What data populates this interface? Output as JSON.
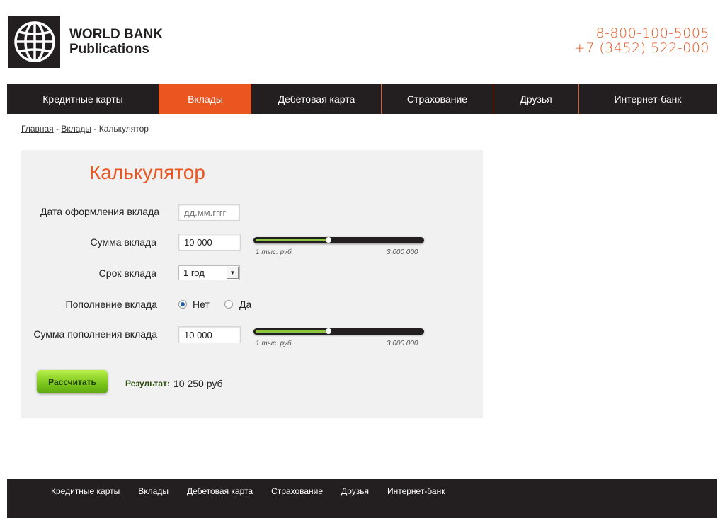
{
  "header": {
    "logo_line1": "WORLD BANK",
    "logo_line2": "Publications",
    "phone1": "8-800-100-5005",
    "phone2": "+7 (3452) 522-000",
    "accent_color": "#ea5520"
  },
  "nav": {
    "items": [
      {
        "label": "Кредитные карты"
      },
      {
        "label": "Вклады",
        "active": true
      },
      {
        "label": "Дебетовая карта"
      },
      {
        "label": "Страхование"
      },
      {
        "label": "Друзья"
      },
      {
        "label": "Интернет-банк"
      }
    ]
  },
  "breadcrumb": {
    "home": "Главная",
    "sep1": " - ",
    "deposits": "Вклады",
    "sep2": " - ",
    "current": "Калькулятор"
  },
  "calculator": {
    "title": "Калькулятор",
    "date_label": "Дата оформления вклада",
    "date_placeholder": "дд.мм.гггг",
    "amount_label": "Сумма вклада",
    "amount_value": "10 000",
    "amount_slider": {
      "min_label": "1 тыс. руб.",
      "max_label": "3 000 000",
      "position": 0.44
    },
    "term_label": "Срок вклада",
    "term_value": "1 год",
    "topup_label": "Пополнение вклада",
    "topup_no": "Нет",
    "topup_yes": "Да",
    "topup_selected": "Нет",
    "topup_amount_label": "Сумма пополнения вклада",
    "topup_amount_value": "10 000",
    "topup_slider": {
      "min_label": "1 тыс. руб.",
      "max_label": "3 000 000",
      "position": 0.44
    },
    "calc_button": "Рассчитать",
    "result_label": "Результат:",
    "result_value": "10 250 руб"
  },
  "footer": {
    "links": [
      {
        "label": "Кредитные карты"
      },
      {
        "label": "Вклады"
      },
      {
        "label": "Дебетовая карта"
      },
      {
        "label": "Страхование"
      },
      {
        "label": "Друзья"
      },
      {
        "label": "Интернет-банк"
      }
    ]
  }
}
